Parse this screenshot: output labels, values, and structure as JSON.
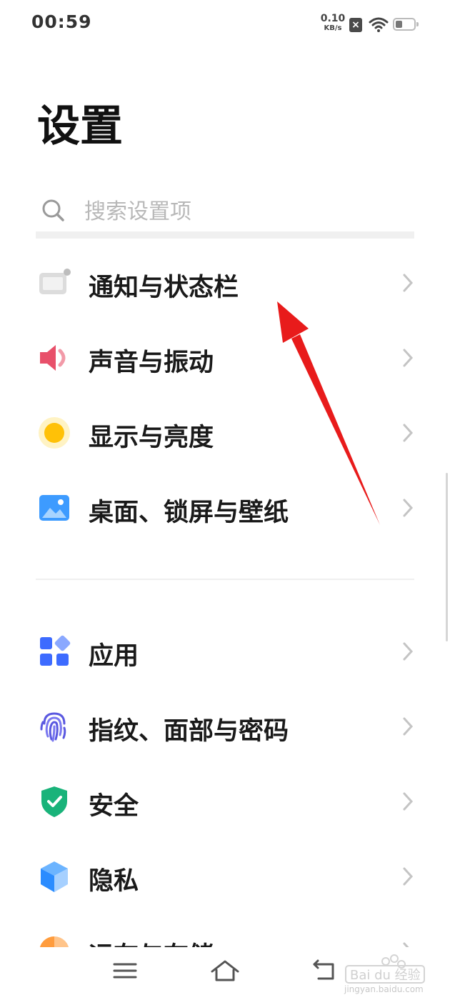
{
  "status": {
    "time": "00:59",
    "net_speed_value": "0.10",
    "net_speed_unit": "KB/s",
    "sim_icon": "sim-no-card-icon",
    "wifi_icon": "wifi-icon",
    "battery_icon": "battery-low-icon"
  },
  "page": {
    "title": "设置"
  },
  "search": {
    "placeholder": "搜索设置项",
    "value": ""
  },
  "items": [
    {
      "label": "通知与状态栏",
      "icon": "notification-statusbar-icon",
      "color": "#cfcfcf"
    },
    {
      "label": "声音与振动",
      "icon": "speaker-icon",
      "color": "#e8506a"
    },
    {
      "label": "显示与亮度",
      "icon": "brightness-icon",
      "color": "#ffc107"
    },
    {
      "label": "桌面、锁屏与壁纸",
      "icon": "wallpaper-icon",
      "color": "#3d9bff"
    },
    {
      "label": "应用",
      "icon": "apps-grid-icon",
      "color": "#3d6bff"
    },
    {
      "label": "指纹、面部与密码",
      "icon": "fingerprint-icon",
      "color": "#5a58e0"
    },
    {
      "label": "安全",
      "icon": "shield-check-icon",
      "color": "#19b37a"
    },
    {
      "label": "隐私",
      "icon": "privacy-cube-icon",
      "color": "#2b8cff"
    },
    {
      "label": "运存与存储",
      "icon": "storage-pie-icon",
      "color": "#ff9c3d"
    }
  ],
  "nav": {
    "menu_icon": "menu-icon",
    "home_icon": "home-icon",
    "back_icon": "back-icon"
  },
  "annotation": {
    "arrow_color": "#e81b1b"
  },
  "watermark": {
    "text": "jingyan.baidu.com",
    "logo": "baidu-jingyan-logo"
  }
}
